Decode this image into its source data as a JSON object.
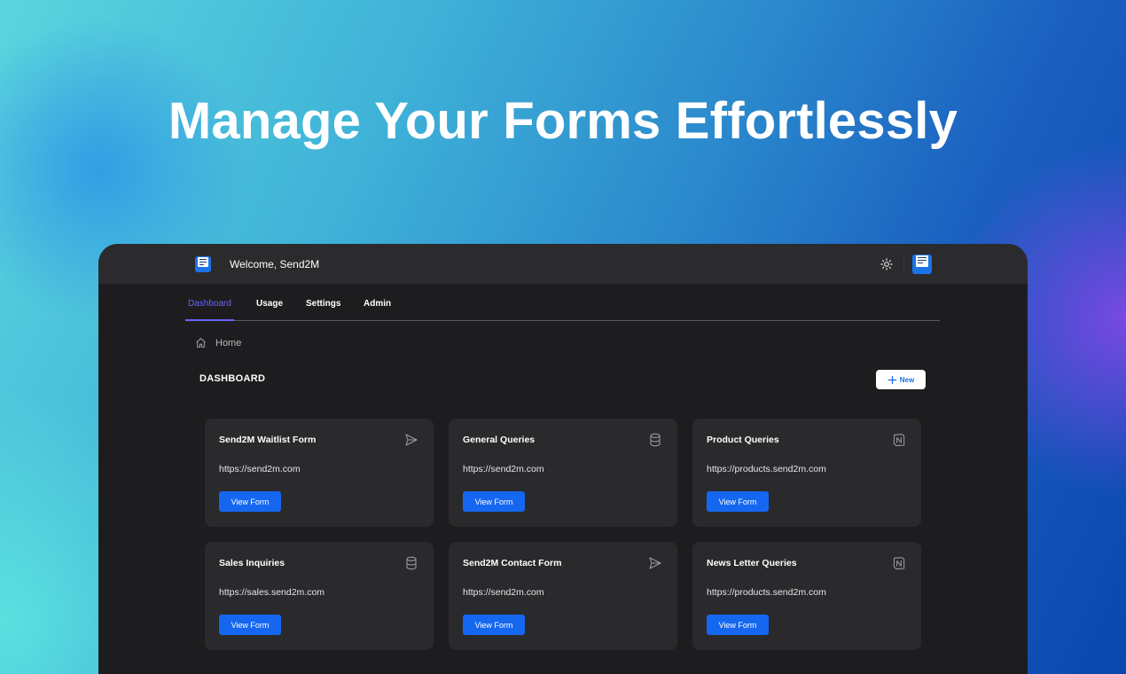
{
  "headline": "Manage Your Forms Effortlessly",
  "app": {
    "welcome": "Welcome, Send2M",
    "accent_color": "#6b63ff",
    "button_color": "#1667f0"
  },
  "tabs": [
    {
      "label": "Dashboard",
      "active": true
    },
    {
      "label": "Usage",
      "active": false
    },
    {
      "label": "Settings",
      "active": false
    },
    {
      "label": "Admin",
      "active": false
    }
  ],
  "breadcrumb": {
    "home": "Home"
  },
  "page": {
    "title": "DASHBOARD",
    "new_button": "New"
  },
  "cards": [
    {
      "title": "Send2M Waitlist Form",
      "url": "https://send2m.com",
      "icon": "send-icon",
      "button": "View Form"
    },
    {
      "title": "General Queries",
      "url": "https://send2m.com",
      "icon": "database-icon",
      "button": "View Form"
    },
    {
      "title": "Product Queries",
      "url": "https://products.send2m.com",
      "icon": "notion-icon",
      "button": "View Form"
    },
    {
      "title": "Sales Inquiries",
      "url": "https://sales.send2m.com",
      "icon": "database-icon",
      "button": "View Form"
    },
    {
      "title": "Send2M Contact Form",
      "url": "https://send2m.com",
      "icon": "send-icon",
      "button": "View Form"
    },
    {
      "title": "News Letter Queries",
      "url": "https://products.send2m.com",
      "icon": "notion-icon",
      "button": "View Form"
    }
  ]
}
